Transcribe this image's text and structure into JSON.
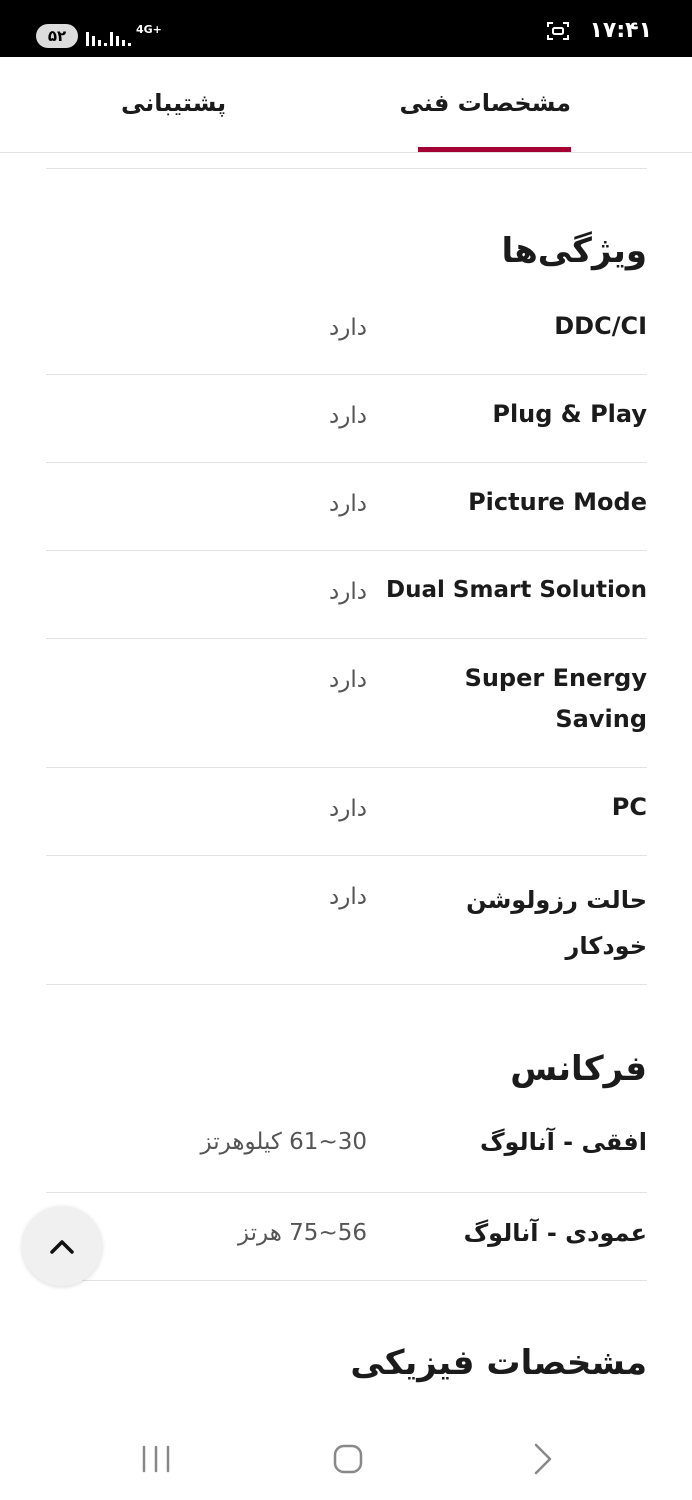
{
  "status_bar": {
    "time": "۱۷:۴۱",
    "battery": "۵۲",
    "network": "4G+"
  },
  "tabs": [
    {
      "label": "مشخصات فنی",
      "active": true
    },
    {
      "label": "پشتیبانی",
      "active": false
    }
  ],
  "accent_color": "#a50034",
  "sections": {
    "features": {
      "title": "ویژگی‌ها",
      "rows": [
        {
          "label": "DDC/CI",
          "value": "دارد"
        },
        {
          "label": "Plug & Play",
          "value": "دارد"
        },
        {
          "label": "Picture Mode",
          "value": "دارد"
        },
        {
          "label": "Dual Smart Solution",
          "value": "دارد"
        },
        {
          "label": "Super Energy Saving",
          "value": "دارد"
        },
        {
          "label": "PC",
          "value": "دارد"
        },
        {
          "label": "حالت رزولوشن خودکار",
          "value": "دارد"
        }
      ]
    },
    "frequency": {
      "title": "فرکانس",
      "rows": [
        {
          "label": "افقی - آنالوگ",
          "value": "30~61 کیلوهرتز"
        },
        {
          "label": "عمودی - آنالوگ",
          "value": "56~75 هرتز"
        }
      ]
    },
    "physical": {
      "title": "مشخصات فیزیکی"
    }
  },
  "icons": {
    "scroll_top": "chevron-up-icon",
    "nav_recents": "recent-apps-icon",
    "nav_home": "home-icon",
    "nav_back": "back-icon"
  }
}
